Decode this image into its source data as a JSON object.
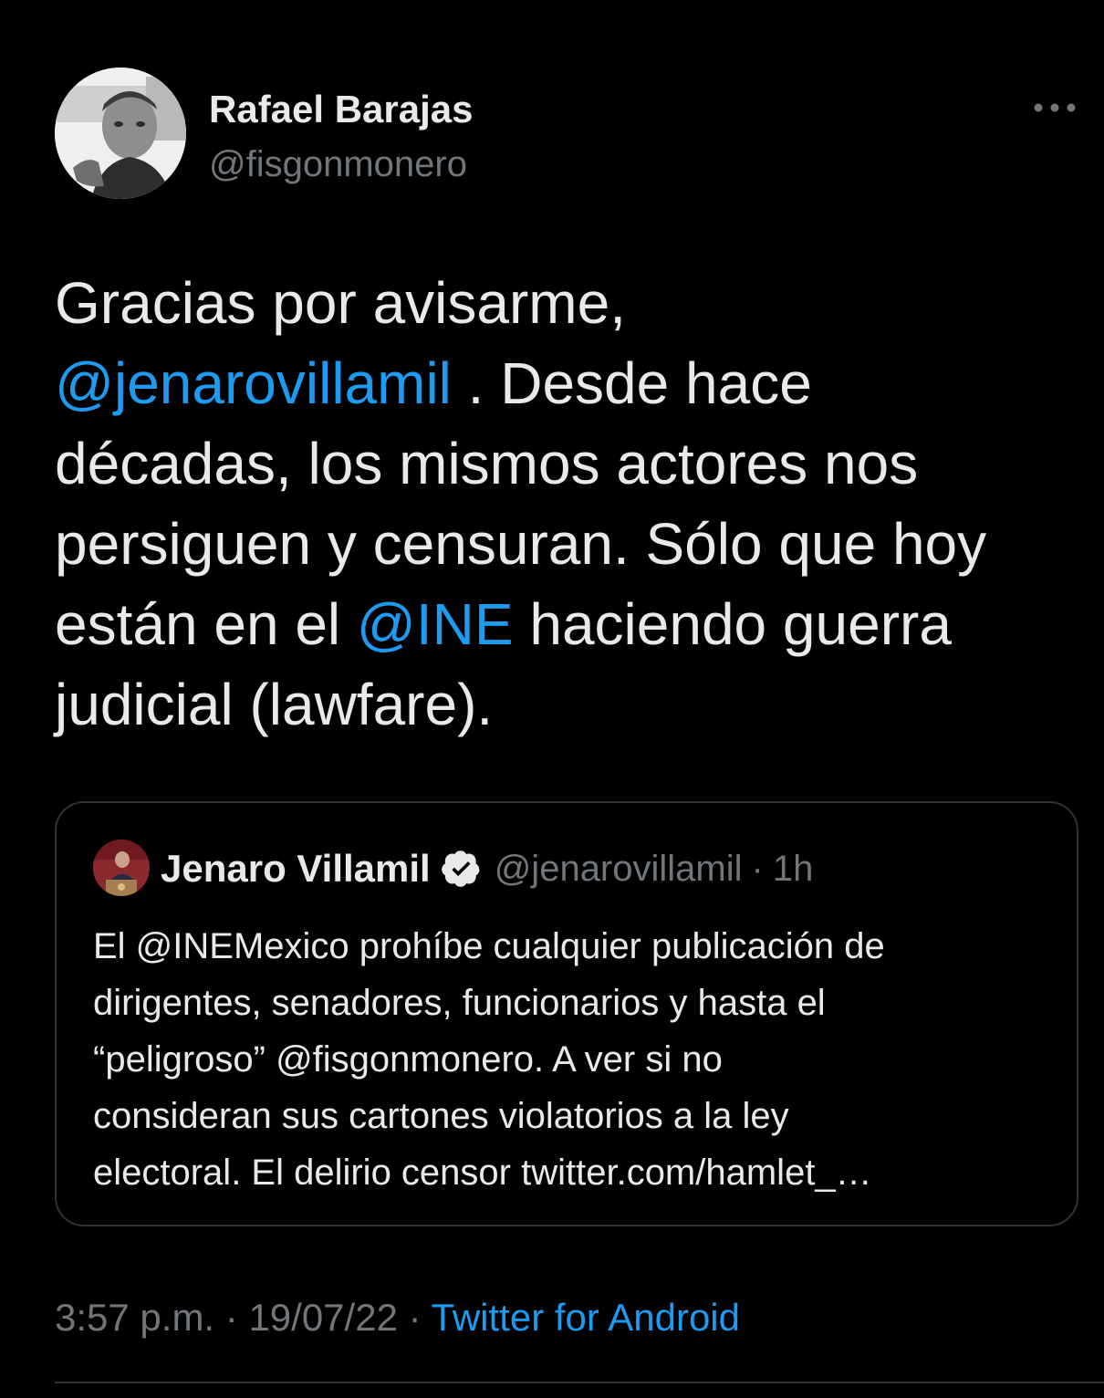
{
  "author": {
    "name": "Rafael Barajas",
    "handle": "@fisgonmonero",
    "avatar_icon": "profile-photo"
  },
  "menu": {
    "icon": "more-options-icon"
  },
  "tweet": {
    "line1": "Gracias por avisarme,",
    "line2_mention": "@jenarovillamil",
    "line2_rest": " . Desde hace",
    "line3": "décadas, los mismos actores nos",
    "line4": "persiguen y censuran. Sólo que hoy",
    "line5_before": "están en el ",
    "line5_mention": "@INE",
    "line5_after": " haciendo guerra",
    "line6": "judicial (lawfare)."
  },
  "quote": {
    "name": "Jenaro Villamil",
    "verified_icon": "verified-badge-icon",
    "handle": "@jenarovillamil",
    "separator": "·",
    "time": "1h",
    "lines": [
      "El @INEMexico prohíbe cualquier publicación de",
      "dirigentes, senadores, funcionarios y hasta el",
      "“peligroso” @fisgonmonero. A ver si no",
      "consideran sus cartones violatorios a la ley",
      "electoral. El delirio censor twitter.com/hamlet_…"
    ]
  },
  "meta": {
    "time": "3:57 p.m.",
    "separator1": " · ",
    "date": "19/07/22",
    "separator2": " · ",
    "source": "Twitter for Android"
  },
  "colors": {
    "background": "#000000",
    "text": "#e7e9ea",
    "muted": "#71767b",
    "link": "#1d9bf0",
    "border": "#2f3336"
  }
}
